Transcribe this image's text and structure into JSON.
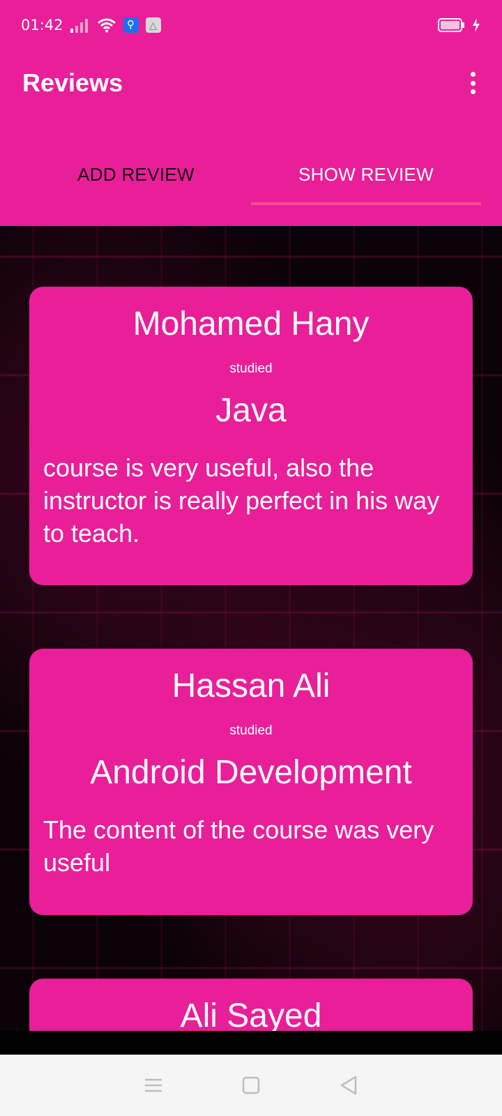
{
  "status_bar": {
    "time": "01:42",
    "usb_icon": "usb-icon",
    "accessibility_icon": "android-debug-icon"
  },
  "app_bar": {
    "title": "Reviews",
    "menu_icon": "more-vert-icon"
  },
  "tabs": [
    {
      "label": "ADD REVIEW",
      "active": false
    },
    {
      "label": "SHOW REVIEW",
      "active": true
    }
  ],
  "reviews": [
    {
      "name": "Mohamed Hany",
      "studied_label": "studied",
      "course": "Java",
      "text": "course is very useful, also the instructor is really perfect in his way to teach."
    },
    {
      "name": "Hassan Ali",
      "studied_label": "studied",
      "course": "Android Development",
      "text": "The content of the course was very useful"
    },
    {
      "name": "Ali Sayed"
    }
  ],
  "colors": {
    "primary": "#e91e99",
    "tab_indicator": "#ff4f8a",
    "background": "#0b0207",
    "nav_bar": "#f5f5f5"
  },
  "nav_bar": {
    "buttons": [
      "menu-icon",
      "home-icon",
      "back-icon"
    ]
  }
}
